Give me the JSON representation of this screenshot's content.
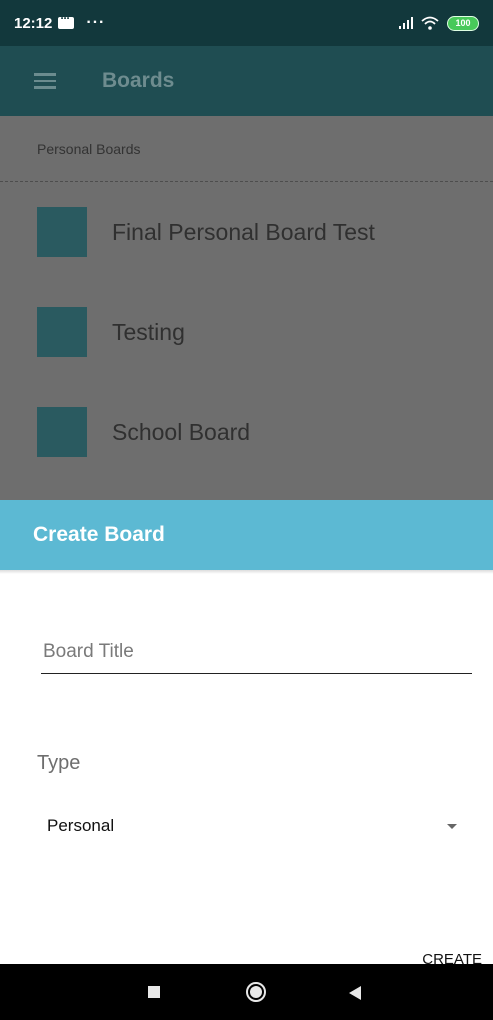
{
  "status_bar": {
    "time": "12:12",
    "overflow": "···",
    "battery": "100",
    "icons": [
      "message-icon",
      "signal-icon",
      "wifi-icon",
      "battery-icon"
    ]
  },
  "app_bar": {
    "title": "Boards",
    "menu_icon": "menu-icon"
  },
  "board_list": {
    "section_header": "Personal Boards",
    "items": [
      {
        "label": "Final Personal Board Test"
      },
      {
        "label": "Testing"
      },
      {
        "label": "School Board"
      }
    ],
    "swatch_color": "#2a5a60"
  },
  "dialog": {
    "title": "Create Board",
    "title_field": {
      "placeholder": "Board Title",
      "value": ""
    },
    "type_label": "Type",
    "type_select": {
      "selected": "Personal"
    },
    "create_label": "CREATE"
  },
  "colors": {
    "status_bar": "#12383c",
    "app_bar": "#1f4d52",
    "dialog_header": "#5cb9d3"
  }
}
